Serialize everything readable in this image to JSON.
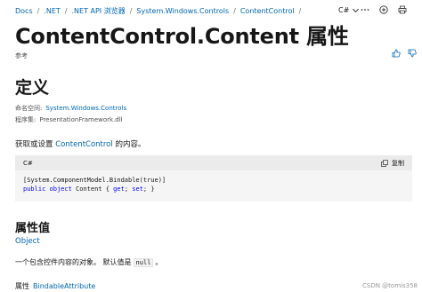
{
  "breadcrumb": [
    "Docs",
    ".NET",
    ".NET API 浏览器",
    "System.Windows.Controls",
    "ContentControl"
  ],
  "breadcrumb_separator": "/",
  "language_selector": {
    "label": "C#"
  },
  "top_icons": [
    "chevron-down-icon",
    "more-options-icon",
    "add-collection-icon",
    "print-icon"
  ],
  "title": "ContentControl.Content 属性",
  "reference_label": "参考",
  "feedback_icons": [
    "thumbs-up-icon",
    "thumbs-down-icon"
  ],
  "definition": {
    "heading": "定义",
    "namespace_label": "命名空间:",
    "namespace_value": "System.Windows.Controls",
    "assembly_label": "程序集:",
    "assembly_value": "PresentationFramework.dll"
  },
  "description": {
    "prefix": "获取或设置",
    "link": "ContentControl",
    "suffix": "的内容。"
  },
  "code": {
    "language": "C#",
    "copy_label": "复制",
    "line1": "[System.ComponentModel.Bindable(true)]",
    "line2_kw1": "public",
    "line2_kw2": "object",
    "line2_name": " Content { ",
    "line2_get": "get",
    "line2_semi": "; ",
    "line2_set": "set",
    "line2_end": "; }"
  },
  "property_value": {
    "heading": "属性值",
    "type_link": "Object",
    "desc_prefix": "一个包含控件内容的对象。 默认值是",
    "default_value": "null",
    "desc_suffix": "。"
  },
  "attribute": {
    "label": "属性",
    "link": "BindableAttribute"
  },
  "watermark": "CSDN @tomis358",
  "colors": {
    "link": "#0065b3",
    "code_header": "#ebebeb",
    "code_bg": "#f5f5f5",
    "keyword": "#0101fd"
  }
}
